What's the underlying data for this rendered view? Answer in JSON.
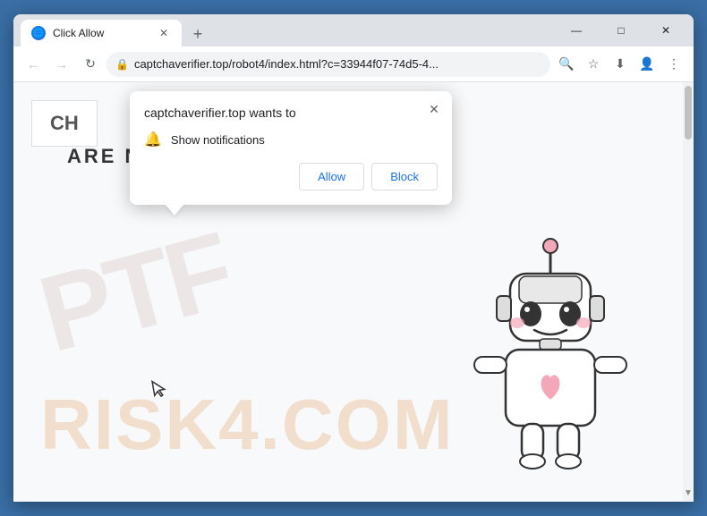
{
  "browser": {
    "tab": {
      "title": "Click Allow",
      "favicon": "🌐"
    },
    "address": "captchaverifier.top/robot4/index.html?c=33944f07-74d5-4...",
    "window_controls": {
      "minimize": "—",
      "maximize": "□",
      "close": "✕"
    },
    "nav": {
      "back": "←",
      "forward": "→",
      "refresh": "↻"
    },
    "new_tab_icon": "+",
    "toolbar": {
      "search_icon": "🔍",
      "star_icon": "☆",
      "profile_icon": "👤",
      "menu_icon": "⋮",
      "download_icon": "⬇"
    }
  },
  "popup": {
    "title": "captchaverifier.top wants to",
    "notification_label": "Show notifications",
    "close_icon": "✕",
    "allow_label": "Allow",
    "block_label": "Block"
  },
  "page": {
    "captcha_partial": "CH",
    "captcha_subtitle": "ARE NOT A ROBOT?",
    "watermark1": "PTF",
    "watermark2": "RISK4.COM",
    "cursor": "↖"
  }
}
